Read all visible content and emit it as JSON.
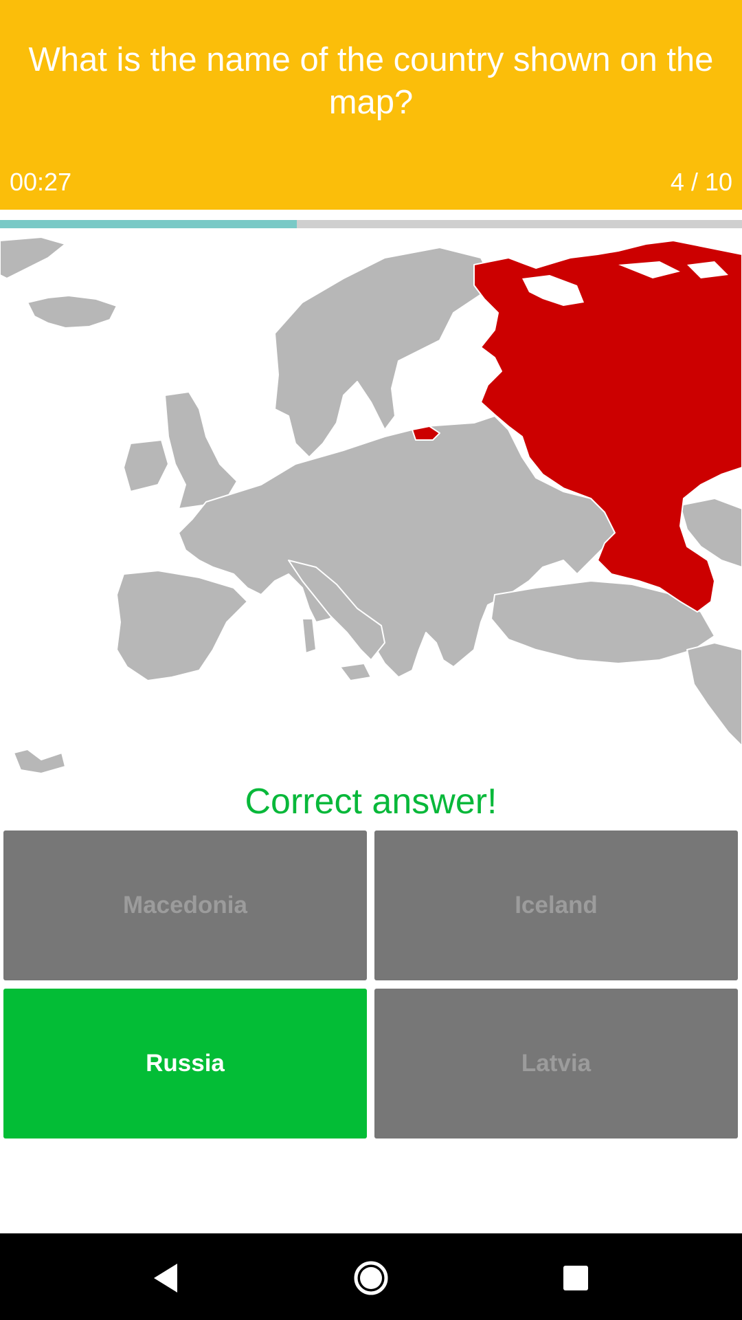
{
  "question": "What is the name of the country shown on the map?",
  "timer": "00:27",
  "counter": "4 / 10",
  "progress": 0.4,
  "colors": {
    "header": "#FBBE0A",
    "progress_fill": "#79C9C6",
    "highlight_country": "#CC0000",
    "correct": "#03BD36",
    "disabled": "#777777"
  },
  "feedback": "Correct answer!",
  "answers": [
    {
      "label": "Macedonia",
      "state": "disabled"
    },
    {
      "label": "Iceland",
      "state": "disabled"
    },
    {
      "label": "Russia",
      "state": "correct"
    },
    {
      "label": "Latvia",
      "state": "disabled"
    }
  ],
  "map": {
    "highlighted_country": "Russia"
  },
  "nav": {
    "back_icon": "back-icon",
    "home_icon": "home-icon",
    "recents_icon": "recents-icon"
  }
}
